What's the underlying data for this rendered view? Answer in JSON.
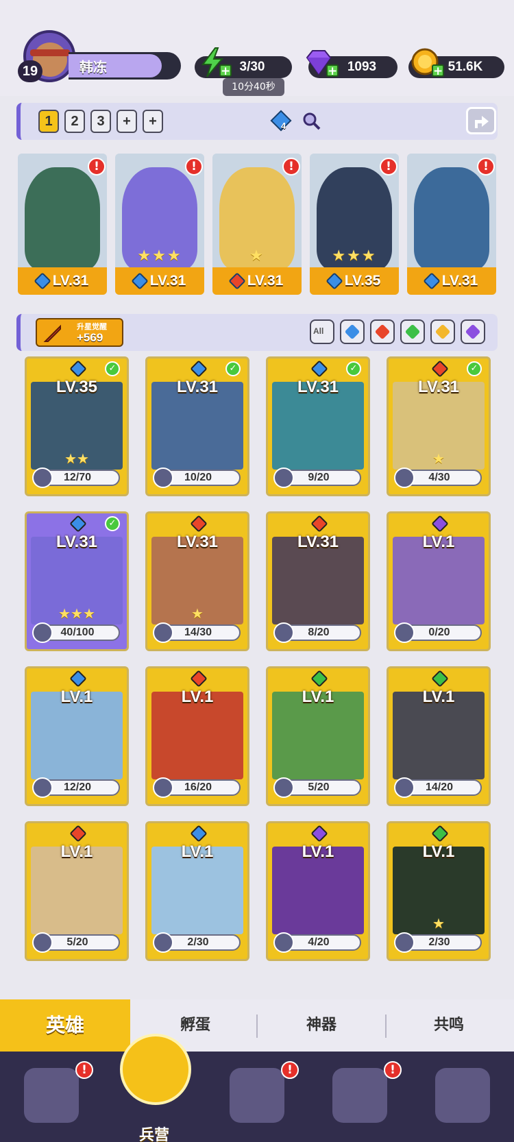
{
  "player": {
    "level": "19",
    "name": "韩冻"
  },
  "resources": {
    "energy": {
      "value": "3/30",
      "timer": "10分40秒",
      "color": "#4fd14a"
    },
    "gems": {
      "value": "1093",
      "color": "#9b5cf2"
    },
    "gold": {
      "value": "51.6K",
      "color": "#f6b21b"
    }
  },
  "team_bar": {
    "tabs": [
      "1",
      "2",
      "3",
      "+",
      "+"
    ],
    "active_tab": "1",
    "badge_count": "4"
  },
  "team": [
    {
      "level": "LV.31",
      "element": "water",
      "stars": "",
      "art_color": "#3c6e58"
    },
    {
      "level": "LV.31",
      "element": "water",
      "stars": "★★★",
      "art_color": "#7d6ed8"
    },
    {
      "level": "LV.31",
      "element": "fire",
      "stars": "★",
      "art_color": "#e8c25a"
    },
    {
      "level": "LV.35",
      "element": "water",
      "stars": "★★★",
      "art_color": "#31405c"
    },
    {
      "level": "LV.31",
      "element": "water",
      "stars": "",
      "art_color": "#3c6a9a"
    }
  ],
  "filter_bar": {
    "awaken_label": "升星觉醒",
    "awaken_value": "+569",
    "all_label": "All"
  },
  "heroes": [
    {
      "level": "LV.35",
      "element": "water",
      "shards": "12/70",
      "stars": "★★",
      "checked": true,
      "art": "#3c5a70"
    },
    {
      "level": "LV.31",
      "element": "water",
      "shards": "10/20",
      "stars": "",
      "checked": true,
      "art": "#4a6b98"
    },
    {
      "level": "LV.31",
      "element": "water",
      "shards": "9/20",
      "stars": "",
      "checked": true,
      "art": "#3c8a96"
    },
    {
      "level": "LV.31",
      "element": "fire",
      "shards": "4/30",
      "stars": "★",
      "checked": true,
      "art": "#d9c17a"
    },
    {
      "level": "LV.31",
      "element": "water",
      "shards": "40/100",
      "stars": "★★★",
      "checked": true,
      "art": "#7a6bd8",
      "purple": true
    },
    {
      "level": "LV.31",
      "element": "fire",
      "shards": "14/30",
      "stars": "★",
      "checked": false,
      "art": "#b5744e"
    },
    {
      "level": "LV.31",
      "element": "fire",
      "shards": "8/20",
      "stars": "",
      "checked": false,
      "art": "#5a4a52"
    },
    {
      "level": "LV.1",
      "element": "dark",
      "shards": "0/20",
      "stars": "",
      "checked": false,
      "art": "#8a6ab8"
    },
    {
      "level": "LV.1",
      "element": "water",
      "shards": "12/20",
      "stars": "",
      "checked": false,
      "art": "#8ab4d8"
    },
    {
      "level": "LV.1",
      "element": "fire",
      "shards": "16/20",
      "stars": "",
      "checked": false,
      "art": "#c8482c"
    },
    {
      "level": "LV.1",
      "element": "nature",
      "shards": "5/20",
      "stars": "",
      "checked": false,
      "art": "#5a9a4a"
    },
    {
      "level": "LV.1",
      "element": "nature",
      "shards": "14/20",
      "stars": "",
      "checked": false,
      "art": "#4a4a52"
    },
    {
      "level": "LV.1",
      "element": "fire",
      "shards": "5/20",
      "stars": "",
      "checked": false,
      "art": "#d8bc8a"
    },
    {
      "level": "LV.1",
      "element": "water",
      "shards": "2/30",
      "stars": "",
      "checked": false,
      "art": "#9cc2e0"
    },
    {
      "level": "LV.1",
      "element": "dark",
      "shards": "4/20",
      "stars": "",
      "checked": false,
      "art": "#6a3a9a"
    },
    {
      "level": "LV.1",
      "element": "nature",
      "shards": "2/30",
      "stars": "★",
      "checked": false,
      "art": "#2a3a2a"
    }
  ],
  "element_colors": {
    "water": "#3b8ee6",
    "fire": "#e8452a",
    "nature": "#3cbf47",
    "light": "#f3b72c",
    "dark": "#8b4fe0"
  },
  "subtabs": [
    "英雄",
    "孵蛋",
    "神器",
    "共鸣"
  ],
  "bottom_nav": {
    "active_label": "兵营"
  }
}
